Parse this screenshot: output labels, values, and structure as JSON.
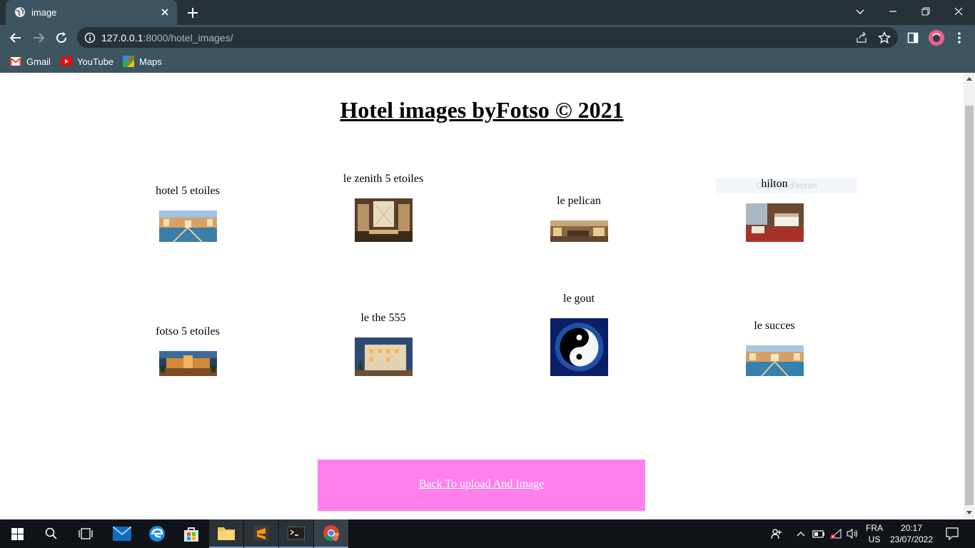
{
  "browser": {
    "tab_title": "image",
    "url_host": "127.0.0.1",
    "url_rest": ":8000/hotel_images/",
    "bookmarks": [
      "Gmail",
      "YouTube",
      "Maps"
    ]
  },
  "page": {
    "title": "Hotel images byFotso © 2021",
    "cards": [
      {
        "caption": "hotel 5 etoiles"
      },
      {
        "caption": "le zenith 5 etoiles"
      },
      {
        "caption": "le pelican"
      },
      {
        "caption": "hilton"
      },
      {
        "caption": "fotso 5 etoiles"
      },
      {
        "caption": "le the 555"
      },
      {
        "caption": "le gout"
      },
      {
        "caption": "le succes"
      }
    ],
    "ghost_overlay": "Capture d'écran",
    "back_link": "Back To upload And Image"
  },
  "taskbar": {
    "lang_top": "FRA",
    "lang_bottom": "US",
    "time": "20:17",
    "date": "23/07/2022"
  },
  "colors": {
    "chrome_dark": "#263238",
    "chrome": "#3c5561",
    "back_box": "#ff80ed"
  }
}
